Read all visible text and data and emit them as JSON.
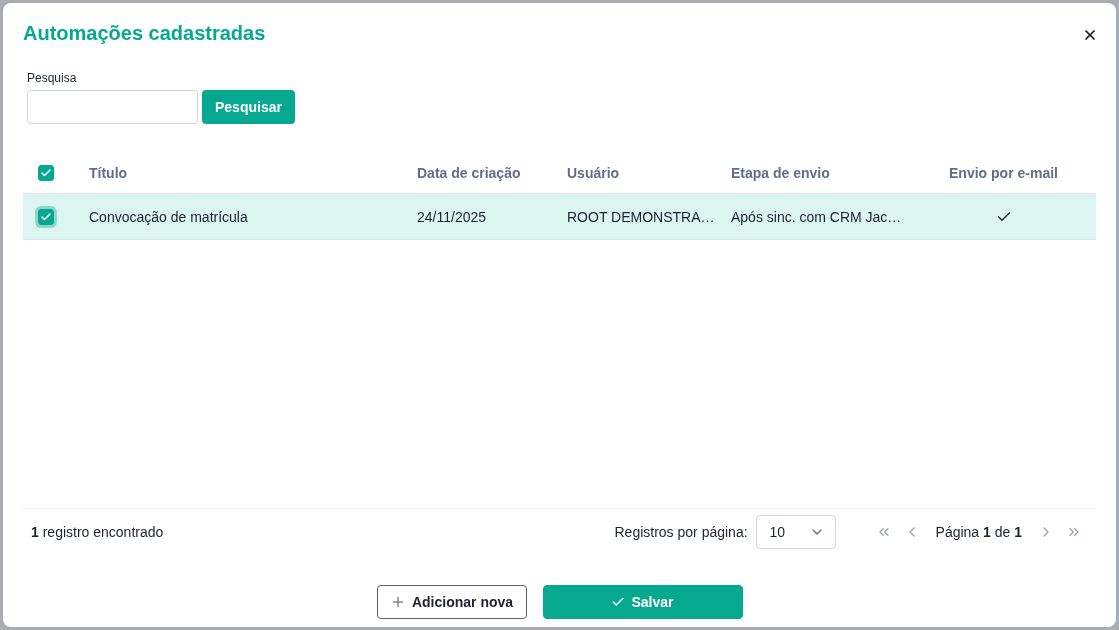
{
  "dialog": {
    "title": "Automações cadastradas"
  },
  "search": {
    "label": "Pesquisa",
    "button": "Pesquisar"
  },
  "table": {
    "select_all_checked": true,
    "columns": [
      "Título",
      "Data de criação",
      "Usuário",
      "Etapa de envio",
      "Envio por e-mail"
    ],
    "rows": [
      {
        "selected": true,
        "checked": true,
        "cells": [
          "Convocação de matrícula",
          "24/11/2025",
          "ROOT DEMONSTRA…",
          "Após sinc. com CRM Jac…"
        ],
        "email": true
      }
    ]
  },
  "footer": {
    "count": "**1** registro encontrado",
    "per_page_label": "Registros por página:",
    "per_page": "10",
    "page": "Página **1** de **1**"
  },
  "actions": [
    {
      "kind": "secondary",
      "label": "Adicionar nova"
    },
    {
      "kind": "primary",
      "label": "Salvar"
    }
  ]
}
